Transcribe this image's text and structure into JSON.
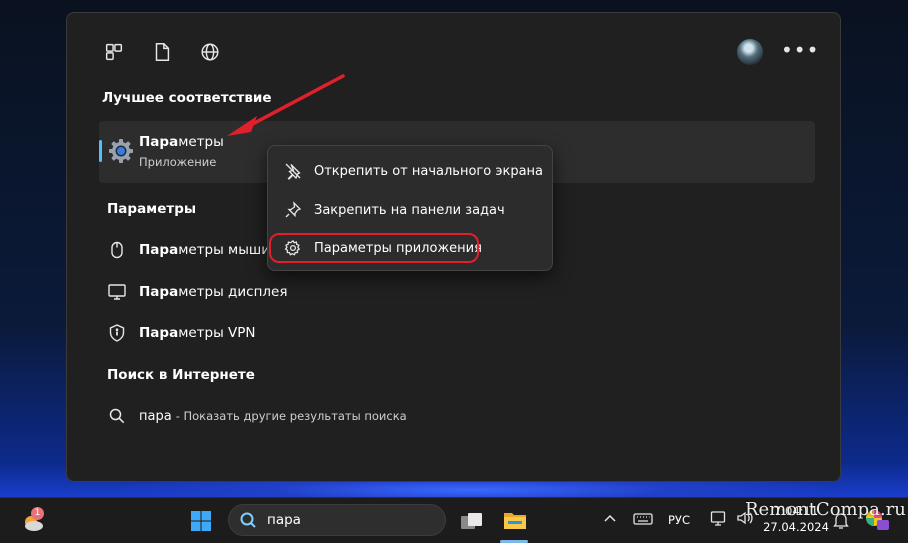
{
  "search_panel": {
    "best_match_title": "Лучшее соответствие",
    "best_match": {
      "name_bold": "Пара",
      "name_rest": "метры",
      "subtitle": "Приложение"
    },
    "settings_title": "Параметры",
    "settings_results": [
      {
        "bold": "Пара",
        "rest": "метры мыши",
        "icon": "mouse-icon"
      },
      {
        "bold": "Пара",
        "rest": "метры дисплея",
        "icon": "display-icon"
      },
      {
        "bold": "Пара",
        "rest": "метры VPN",
        "icon": "shield-icon"
      }
    ],
    "web_title": "Поиск в Интернете",
    "web_result": {
      "query": "пара",
      "rest": "- Показать другие результаты поиска"
    }
  },
  "context_menu": {
    "items": [
      {
        "label": "Открепить от начального экрана",
        "icon": "unpin-icon"
      },
      {
        "label": "Закрепить на панели задач",
        "icon": "pin-icon"
      },
      {
        "label": "Параметры приложения",
        "icon": "gear-icon"
      }
    ]
  },
  "taskbar": {
    "weather_badge": "1",
    "search_text": "пара",
    "language": "РУС",
    "time": "7:04:11",
    "date": "27.04.2024"
  },
  "watermark": "RemontCompa.ru",
  "colors": {
    "accent": "#4cc2ff",
    "highlight_border": "#e0202a",
    "arrow": "#e0202a"
  }
}
